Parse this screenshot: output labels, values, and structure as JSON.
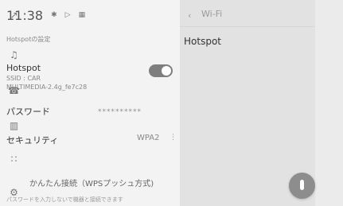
{
  "status": {
    "time": "11:38",
    "icon1": "✱",
    "icon2": "▷",
    "icon3": "▦"
  },
  "left_panel": {
    "section_label": "Hotspotの設定",
    "hotspot_title": "Hotspot",
    "ssid_line1": "SSID : CAR",
    "ssid_line2": "MULTIMEDIA-2.4g_fe7c28",
    "password_label": "パスワード",
    "password_value": "**********",
    "security_label": "セキュリティ",
    "security_value": "WPA2",
    "security_caret": "⋮",
    "wps_label": "かんたん接続（WPSプッシュ方式)",
    "wps_sub": "パスワードを入力しないで機器と接続できます"
  },
  "right_panel": {
    "back_icon": "‹",
    "title": "Wi-Fi",
    "selected_item": "Hotspot"
  },
  "rail": {
    "icons": {
      "nav": "↗",
      "music": "♫",
      "phone": "☎",
      "car": "▥",
      "apps": "∷",
      "settings": "⚙"
    }
  },
  "toggle": {
    "on": true
  },
  "fab": {
    "icon": "mic"
  }
}
